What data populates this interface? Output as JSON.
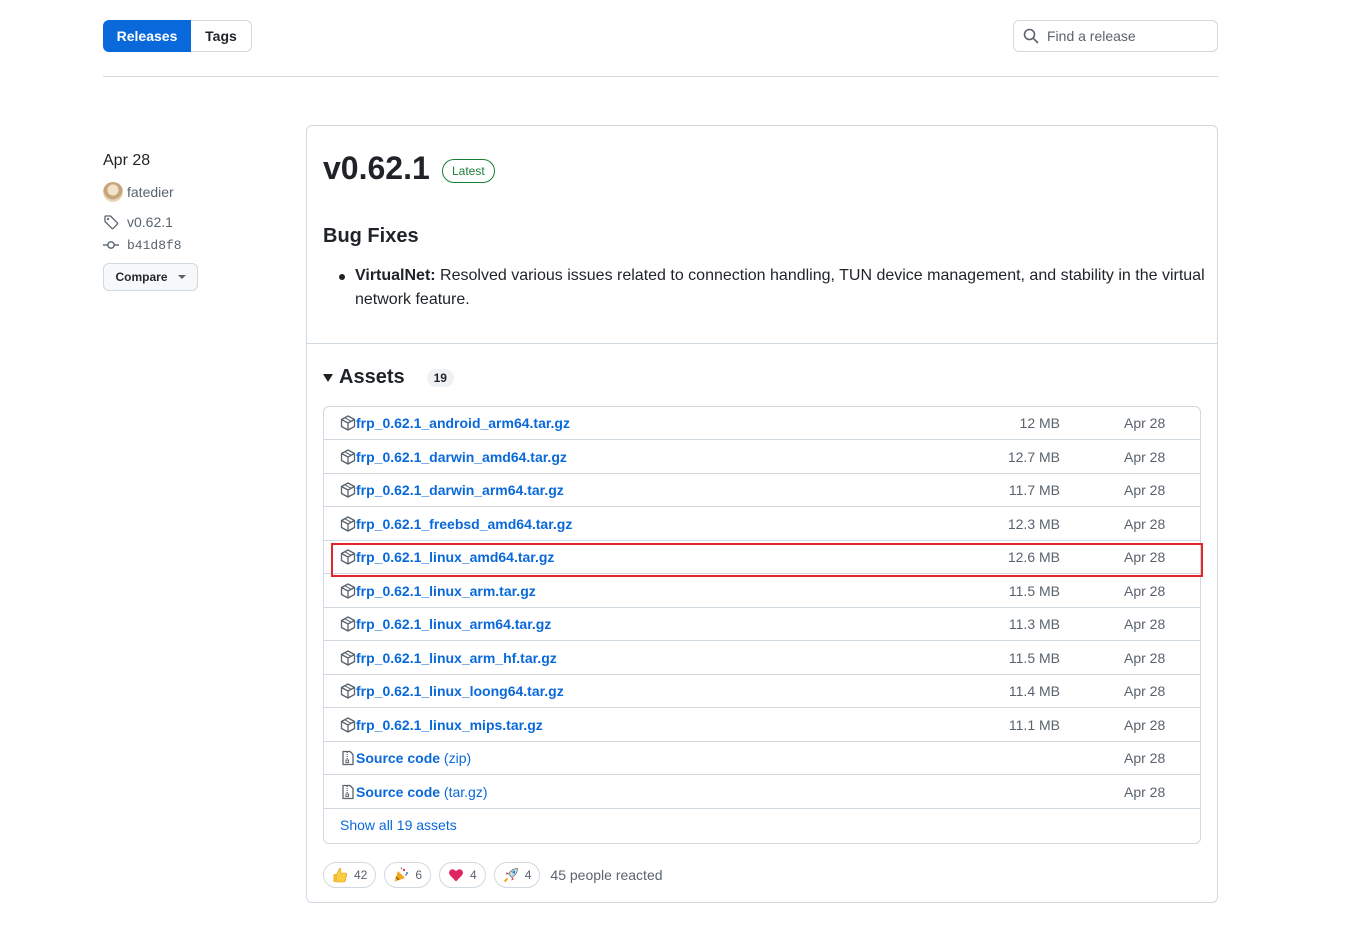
{
  "nav": {
    "releases_label": "Releases",
    "tags_label": "Tags"
  },
  "search": {
    "placeholder": "Find a release"
  },
  "sidebar": {
    "date": "Apr 28",
    "author": "fatedier",
    "tag": "v0.62.1",
    "commit": "b41d8f8",
    "compare_label": "Compare"
  },
  "release": {
    "title": "v0.62.1",
    "badge": "Latest",
    "section_title": "Bug Fixes",
    "notes": [
      {
        "bold": "VirtualNet:",
        "text": " Resolved various issues related to connection handling, TUN device management, and stability in the virtual network feature."
      }
    ]
  },
  "assets": {
    "title": "Assets",
    "count": "19",
    "items": [
      {
        "name": "frp_0.62.1_android_arm64.tar.gz",
        "size": "12 MB",
        "date": "Apr 28"
      },
      {
        "name": "frp_0.62.1_darwin_amd64.tar.gz",
        "size": "12.7 MB",
        "date": "Apr 28"
      },
      {
        "name": "frp_0.62.1_darwin_arm64.tar.gz",
        "size": "11.7 MB",
        "date": "Apr 28"
      },
      {
        "name": "frp_0.62.1_freebsd_amd64.tar.gz",
        "size": "12.3 MB",
        "date": "Apr 28"
      },
      {
        "name": "frp_0.62.1_linux_amd64.tar.gz",
        "size": "12.6 MB",
        "date": "Apr 28"
      },
      {
        "name": "frp_0.62.1_linux_arm.tar.gz",
        "size": "11.5 MB",
        "date": "Apr 28"
      },
      {
        "name": "frp_0.62.1_linux_arm64.tar.gz",
        "size": "11.3 MB",
        "date": "Apr 28"
      },
      {
        "name": "frp_0.62.1_linux_arm_hf.tar.gz",
        "size": "11.5 MB",
        "date": "Apr 28"
      },
      {
        "name": "frp_0.62.1_linux_loong64.tar.gz",
        "size": "11.4 MB",
        "date": "Apr 28"
      },
      {
        "name": "frp_0.62.1_linux_mips.tar.gz",
        "size": "11.1 MB",
        "date": "Apr 28"
      }
    ],
    "source": [
      {
        "name": "Source code",
        "suffix": "(zip)",
        "date": "Apr 28"
      },
      {
        "name": "Source code",
        "suffix": "(tar.gz)",
        "date": "Apr 28"
      }
    ],
    "show_all_label": "Show all 19 assets"
  },
  "reactions": {
    "items": [
      {
        "icon": "thumbs-up-icon",
        "count": "42"
      },
      {
        "icon": "party-popper-icon",
        "count": "6"
      },
      {
        "icon": "heart-icon",
        "count": "4"
      },
      {
        "icon": "rocket-icon",
        "count": "4"
      }
    ],
    "summary": "45 people reacted"
  },
  "colors": {
    "accent": "#0969da",
    "latest": "#1a7f37",
    "highlight": "#e5262b"
  }
}
